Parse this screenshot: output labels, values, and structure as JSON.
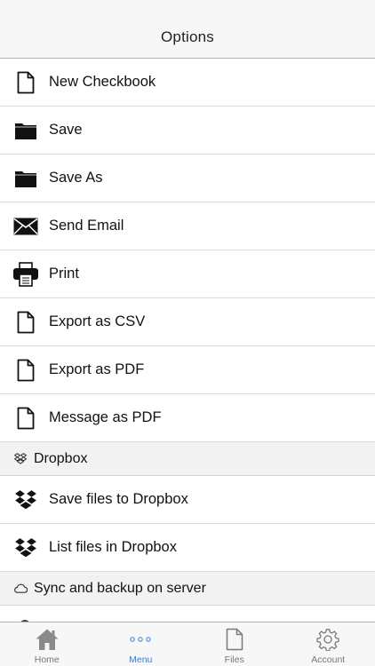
{
  "navbar": {
    "title": "Options"
  },
  "rows_main": [
    {
      "label": "New Checkbook",
      "icon": "document-icon"
    },
    {
      "label": "Save",
      "icon": "folder-icon"
    },
    {
      "label": "Save As",
      "icon": "folder-icon"
    },
    {
      "label": "Send Email",
      "icon": "envelope-icon"
    },
    {
      "label": "Print",
      "icon": "printer-icon"
    },
    {
      "label": "Export as CSV",
      "icon": "document-icon"
    },
    {
      "label": "Export as PDF",
      "icon": "document-icon"
    },
    {
      "label": "Message as PDF",
      "icon": "document-icon"
    }
  ],
  "section_dropbox": {
    "label": "Dropbox",
    "icon": "dropbox-icon"
  },
  "rows_dropbox": [
    {
      "label": "Save files to Dropbox",
      "icon": "dropbox-icon"
    },
    {
      "label": "List files in Dropbox",
      "icon": "dropbox-icon"
    }
  ],
  "section_sync": {
    "label": "Sync and backup on server",
    "icon": "cloud-icon"
  },
  "tabbar": {
    "active_color": "#2f7fe0",
    "tabs": [
      {
        "label": "Home",
        "icon": "home-icon"
      },
      {
        "label": "Menu",
        "icon": "ellipsis-icon"
      },
      {
        "label": "Files",
        "icon": "file-icon"
      },
      {
        "label": "Account",
        "icon": "gear-icon"
      }
    ]
  }
}
